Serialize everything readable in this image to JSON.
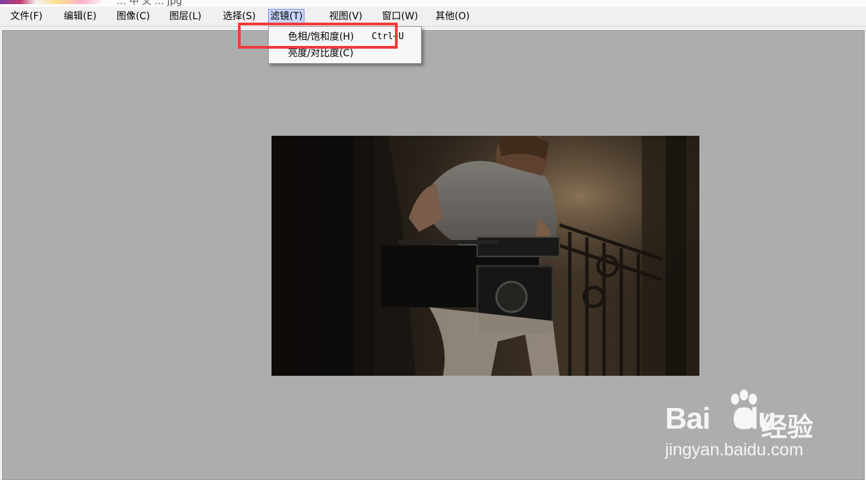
{
  "window": {
    "title_fragment": "… 中 文 … jpg"
  },
  "menubar": {
    "items": [
      {
        "label": "文件(F)",
        "name": "menu-file"
      },
      {
        "label": "编辑(E)",
        "name": "menu-edit"
      },
      {
        "label": "图像(C)",
        "name": "menu-image"
      },
      {
        "label": "图层(L)",
        "name": "menu-layer"
      },
      {
        "label": "选择(S)",
        "name": "menu-select"
      },
      {
        "label": "滤镜(T)",
        "name": "menu-filter",
        "active": true
      },
      {
        "label": "视图(V)",
        "name": "menu-view"
      },
      {
        "label": "窗口(W)",
        "name": "menu-window"
      },
      {
        "label": "其他(O)",
        "name": "menu-other"
      }
    ]
  },
  "filter_menu": {
    "items": [
      {
        "label": "色相/饱和度(H)",
        "shortcut": "Ctrl+U",
        "highlighted": true
      },
      {
        "label": "亮度/对比度(C)",
        "shortcut": ""
      }
    ]
  },
  "canvas": {
    "background_color": "#adadad",
    "image_description_icon": "camera-operator-photo"
  },
  "highlight": {
    "color": "#f23a3a"
  },
  "watermark": {
    "brand": "Bai",
    "brand2": "du",
    "chinese": "经验",
    "url": "jingyan.baidu.com"
  }
}
